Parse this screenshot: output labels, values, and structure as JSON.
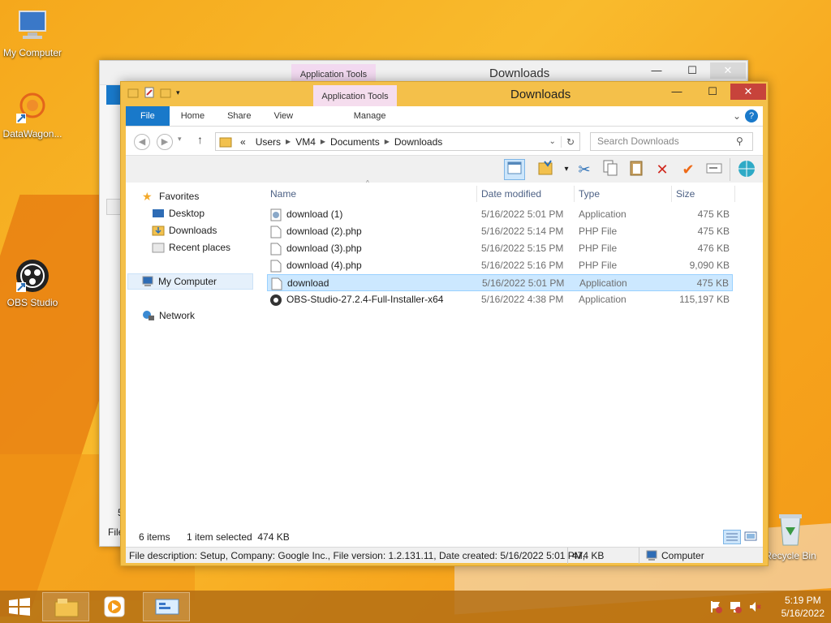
{
  "colors": {
    "window_frame": "#f4c04a",
    "selection": "#cce8ff",
    "file_tab": "#1979ca",
    "close": "#c7433b",
    "app_tools": "#f5ddee"
  },
  "desktop": {
    "icons": [
      {
        "label": "My Computer",
        "icon": "computer-icon"
      },
      {
        "label": "DataWagon...",
        "icon": "datawagon-shortcut-icon"
      },
      {
        "label": "OBS Studio",
        "icon": "obs-shortcut-icon"
      },
      {
        "label": "Recycle Bin",
        "icon": "recycle-bin-icon"
      }
    ]
  },
  "back_window": {
    "title": "Downloads",
    "context_tab": "Application Tools",
    "side_fragments": [
      "File",
      "5"
    ]
  },
  "window": {
    "title": "Downloads",
    "context_tab": "Application Tools",
    "controls": {
      "minimize": "—",
      "maximize": "☐",
      "close": "✕"
    },
    "ribbon_tabs": {
      "file": "File",
      "home": "Home",
      "share": "Share",
      "view": "View",
      "manage": "Manage"
    },
    "address": {
      "prefix": "«",
      "crumbs": [
        "Users",
        "VM4",
        "Documents",
        "Downloads"
      ]
    },
    "search_placeholder": "Search Downloads",
    "nav": {
      "favorites": "Favorites",
      "desktop": "Desktop",
      "downloads": "Downloads",
      "recent": "Recent places",
      "my_computer": "My Computer",
      "network": "Network"
    },
    "columns": {
      "name": "Name",
      "date": "Date modified",
      "type": "Type",
      "size": "Size"
    },
    "files": [
      {
        "name": "download (1)",
        "date": "5/16/2022 5:01 PM",
        "type": "Application",
        "size": "475 KB",
        "icon": "application-icon"
      },
      {
        "name": "download (2).php",
        "date": "5/16/2022 5:14 PM",
        "type": "PHP File",
        "size": "475 KB",
        "icon": "file-icon"
      },
      {
        "name": "download (3).php",
        "date": "5/16/2022 5:15 PM",
        "type": "PHP File",
        "size": "476 KB",
        "icon": "file-icon"
      },
      {
        "name": "download (4).php",
        "date": "5/16/2022 5:16 PM",
        "type": "PHP File",
        "size": "9,090 KB",
        "icon": "file-icon"
      },
      {
        "name": "download",
        "date": "5/16/2022 5:01 PM",
        "type": "Application",
        "size": "475 KB",
        "icon": "file-icon",
        "selected": true
      },
      {
        "name": "OBS-Studio-27.2.4-Full-Installer-x64",
        "date": "5/16/2022 4:38 PM",
        "type": "Application",
        "size": "115,197 KB",
        "icon": "obs-icon"
      }
    ],
    "status": {
      "items": "6 items",
      "selected": "1 item selected  474 KB"
    },
    "details": {
      "text": "File description: Setup, Company: Google Inc., File version: 1.2.131.11, Date created: 5/16/2022 5:01 PM,",
      "size": "474 KB",
      "location": "Computer"
    }
  },
  "taskbar": {
    "time": "5:19 PM",
    "date": "5/16/2022"
  }
}
